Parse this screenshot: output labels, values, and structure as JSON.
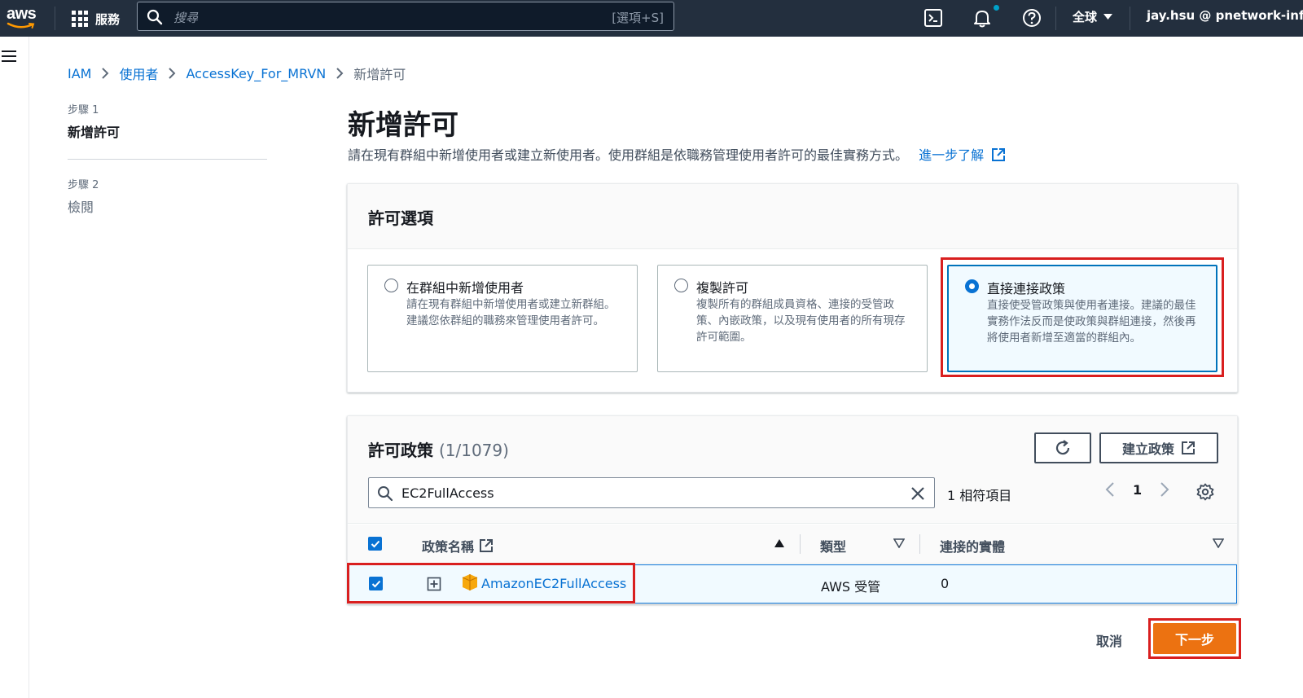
{
  "topbar": {
    "logo_text": "aws",
    "services_label": "服務",
    "search_placeholder": "搜尋",
    "search_shortcut": "[選項+S]",
    "region_label": "全球",
    "user_label": "jay.hsu @ pnetwork-infr"
  },
  "breadcrumb": {
    "items": [
      "IAM",
      "使用者",
      "AccessKey_For_MRVN"
    ],
    "current": "新增許可"
  },
  "steps": [
    {
      "label": "步驟 1",
      "title": "新增許可"
    },
    {
      "label": "步驟 2",
      "title": "檢閱"
    }
  ],
  "page": {
    "title": "新增許可",
    "description": "請在現有群組中新增使用者或建立新使用者。使用群組是依職務管理使用者許可的最佳實務方式。",
    "learn_more": "進一步了解"
  },
  "permission_options": {
    "title": "許可選項",
    "options": [
      {
        "title": "在群組中新增使用者",
        "desc": "請在現有群組中新增使用者或建立新群組。建議您依群組的職務來管理使用者許可。",
        "selected": false
      },
      {
        "title": "複製許可",
        "desc": "複製所有的群組成員資格、連接的受管政策、內嵌政策，以及現有使用者的所有現存許可範圍。",
        "selected": false
      },
      {
        "title": "直接連接政策",
        "desc": "直接使受管政策與使用者連接。建議的最佳實務作法反而是使政策與群組連接，然後再將使用者新增至適當的群組內。",
        "selected": true
      }
    ]
  },
  "policies": {
    "title": "許可政策",
    "count": "(1/1079)",
    "create_button": "建立政策",
    "filter_value": "EC2FullAccess",
    "match_text": "1 相符項目",
    "current_page": "1",
    "columns": [
      "政策名稱",
      "類型",
      "連接的實體"
    ],
    "rows": [
      {
        "name": "AmazonEC2FullAccess",
        "type": "AWS 受管",
        "attached": "0",
        "checked": true
      }
    ]
  },
  "footer": {
    "cancel_label": "取消",
    "next_label": "下一步"
  },
  "colors": {
    "topbar": "#232f3e",
    "link": "#0972d3",
    "primary_button": "#ec7211",
    "highlight": "#d91f1f"
  }
}
